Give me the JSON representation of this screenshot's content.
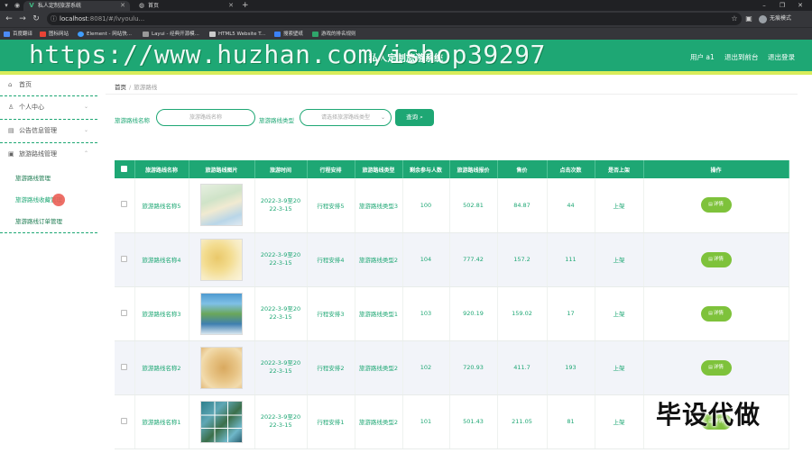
{
  "browser": {
    "tabs": [
      {
        "title": "私人定制旅游系统",
        "favicon": "V",
        "active": true
      },
      {
        "title": "首页",
        "favicon": "globe",
        "active": false
      }
    ],
    "url_host": "localhost",
    "url_rest": ":8081/#/lvyoulu...",
    "profile": "无痕模式",
    "bookmarks": [
      "百度翻译",
      "图标网站",
      "Element - 网站快...",
      "Layui - 经典开源模...",
      "HTML5 Website T...",
      "搜索壁纸",
      "游戏的排名规则"
    ]
  },
  "header": {
    "title": "私人定制旅游系统",
    "user": "用户 a1",
    "logout_to_front": "退出到前台",
    "logout": "退出登录"
  },
  "sidebar": {
    "items": [
      {
        "icon": "home-icon",
        "label": "首页"
      },
      {
        "icon": "user-icon",
        "label": "个人中心"
      },
      {
        "icon": "notice-icon",
        "label": "公告信息管理"
      },
      {
        "icon": "route-icon",
        "label": "旅游路线管理"
      }
    ],
    "sub_items": [
      "旅游路线管理",
      "旅游路线收藏管理",
      "旅游路线订单管理"
    ]
  },
  "breadcrumb": {
    "home": "首页",
    "current": "旅游路线"
  },
  "search": {
    "name_label": "旅游路线名称",
    "name_placeholder": "旅游路线名称",
    "type_label": "旅游路线类型",
    "type_placeholder": "请选择旅游路线类型",
    "button": "查询"
  },
  "table": {
    "headers": [
      "旅游路线名称",
      "旅游路线图片",
      "旅游时间",
      "行程安排",
      "旅游路线类型",
      "剩余参与人数",
      "旅游路线报价",
      "售价",
      "点击次数",
      "是否上架",
      "操作"
    ],
    "detail_label": "详情",
    "rows": [
      {
        "name": "旅游路线名称5",
        "time1": "2022-3-9至20",
        "time2": "22-3-15",
        "schedule": "行程安排5",
        "type": "旅游路线类型3",
        "remaining": "100",
        "quote": "502.81",
        "price": "84.87",
        "clicks": "44",
        "onsale": "上架"
      },
      {
        "name": "旅游路线名称4",
        "time1": "2022-3-9至20",
        "time2": "22-3-15",
        "schedule": "行程安排4",
        "type": "旅游路线类型2",
        "remaining": "104",
        "quote": "777.42",
        "price": "157.2",
        "clicks": "111",
        "onsale": "上架"
      },
      {
        "name": "旅游路线名称3",
        "time1": "2022-3-9至20",
        "time2": "22-3-15",
        "schedule": "行程安排3",
        "type": "旅游路线类型1",
        "remaining": "103",
        "quote": "920.19",
        "price": "159.02",
        "clicks": "17",
        "onsale": "上架"
      },
      {
        "name": "旅游路线名称2",
        "time1": "2022-3-9至20",
        "time2": "22-3-15",
        "schedule": "行程安排2",
        "type": "旅游路线类型2",
        "remaining": "102",
        "quote": "720.93",
        "price": "411.7",
        "clicks": "193",
        "onsale": "上架"
      },
      {
        "name": "旅游路线名称1",
        "time1": "2022-3-9至20",
        "time2": "22-3-15",
        "schedule": "行程安排1",
        "type": "旅游路线类型2",
        "remaining": "101",
        "quote": "501.43",
        "price": "211.05",
        "clicks": "81",
        "onsale": "上架"
      }
    ]
  },
  "overlays": {
    "url_watermark": "https://www.huzhan.com/ishop39297",
    "corner_text": "毕设代做"
  },
  "colors": {
    "primary": "#1ea774",
    "accent_stripe": "#d8ec5a",
    "detail_button": "#7ec23b",
    "row_alt": "#f2f4f9"
  }
}
